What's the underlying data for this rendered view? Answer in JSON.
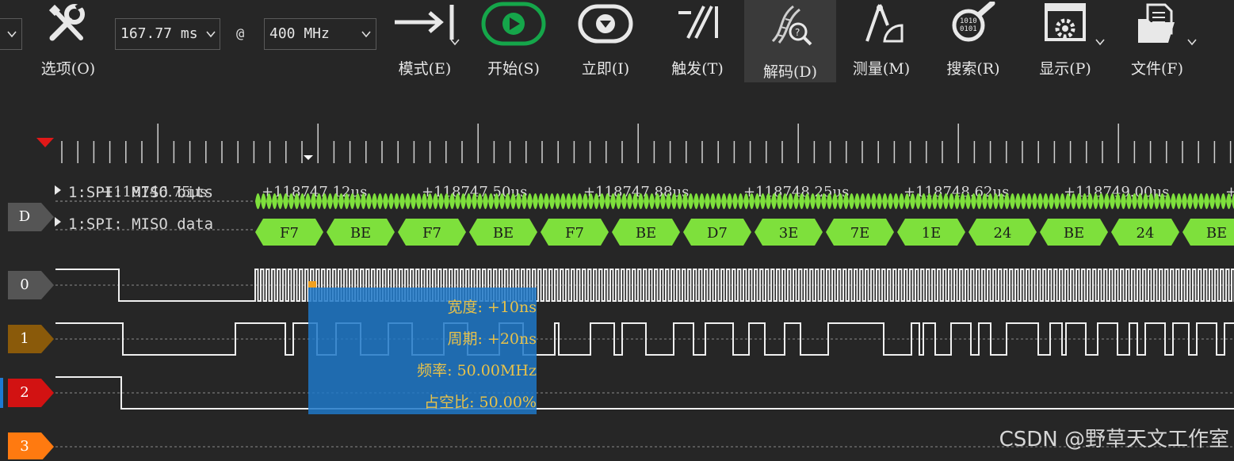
{
  "toolbar": {
    "options_label": "选项(O)",
    "duration_value": "167.77 ms",
    "at_symbol": "@",
    "rate_value": "400 MHz",
    "mode_label": "模式(E)",
    "start_label": "开始(S)",
    "immediate_label": "立即(I)",
    "trigger_label": "触发(T)",
    "decode_label": "解码(D)",
    "measure_label": "测量(M)",
    "search_label": "搜索(R)",
    "display_label": "显示(P)",
    "file_label": "文件(F)"
  },
  "ruler": {
    "times": [
      "+118746.75μs",
      "+118747.12μs",
      "+118747.50μs",
      "+118747.88μs",
      "+118748.25μs",
      "+118748.62μs",
      "+118749.00μs",
      "+"
    ]
  },
  "decoder": {
    "tag": "D",
    "row_bits_label": "1:SPI: MISO bits",
    "row_data_label": "1:SPI: MISO data",
    "bytes": [
      "F7",
      "BE",
      "F7",
      "BE",
      "F7",
      "BE",
      "D7",
      "3E",
      "7E",
      "1E",
      "24",
      "BE",
      "24",
      "BE"
    ]
  },
  "channels": [
    {
      "id": "0",
      "color": "#555555"
    },
    {
      "id": "1",
      "color": "#8a5a0a"
    },
    {
      "id": "2",
      "color": "#d21212"
    },
    {
      "id": "3",
      "color": "#ff7a10"
    }
  ],
  "colors": {
    "decode_green": "#7ee03c",
    "waveform": "#f0f0f0",
    "tooltip_text": "#e8c24a",
    "trigger_red": "#e01818"
  },
  "tooltip": {
    "width": "宽度: +10ns",
    "period": "周期: +20ns",
    "frequency": "频率: 50.00MHz",
    "duty": "占空比: 50.00%"
  },
  "watermark": "CSDN @野草天文工作室"
}
